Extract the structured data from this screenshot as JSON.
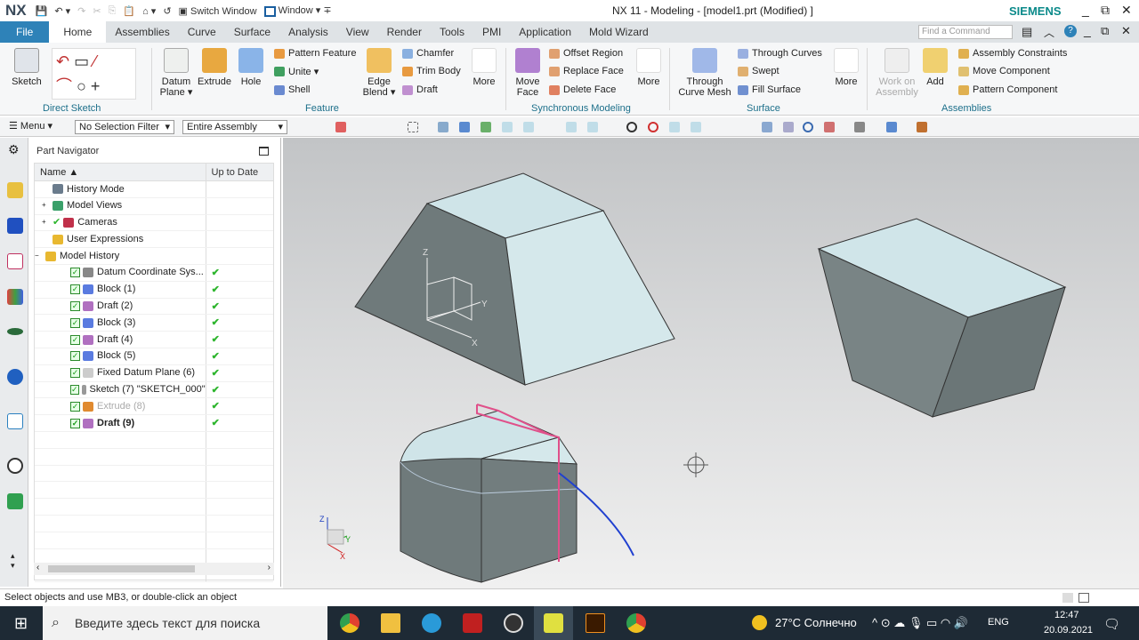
{
  "titlebar": {
    "logo": "NX",
    "switch_window": "Switch Window",
    "window": "Window ▾",
    "title": "NX 11 - Modeling - [model1.prt (Modified) ]",
    "brand": "SIEMENS",
    "minimize": "_",
    "restore": "⧉",
    "close": "✕"
  },
  "tabs": [
    "File",
    "Home",
    "Assemblies",
    "Curve",
    "Surface",
    "Analysis",
    "View",
    "Render",
    "Tools",
    "PMI",
    "Application",
    "Mold Wizard"
  ],
  "find_command": {
    "placeholder": "Find a Command"
  },
  "ribbon": {
    "sketch": "Sketch",
    "direct_sketch": "Direct Sketch",
    "datum_plane": "Datum Plane ▾",
    "extrude": "Extrude",
    "hole": "Hole",
    "pattern_feature": "Pattern Feature",
    "unite": "Unite ▾",
    "shell": "Shell",
    "edge_blend": "Edge Blend ▾",
    "chamfer": "Chamfer",
    "trim_body": "Trim Body",
    "draft": "Draft",
    "more": "More",
    "feature": "Feature",
    "move_face": "Move Face",
    "offset_region": "Offset Region",
    "replace_face": "Replace Face",
    "delete_face": "Delete Face",
    "sync_modeling": "Synchronous Modeling",
    "through_curve_mesh": "Through Curve Mesh",
    "through_curves": "Through Curves",
    "swept": "Swept",
    "fill_surface": "Fill Surface",
    "surface": "Surface",
    "work_on_assembly": "Work on Assembly",
    "add": "Add",
    "assembly_constraints": "Assembly Constraints",
    "move_component": "Move Component",
    "pattern_component": "Pattern Component",
    "assemblies": "Assemblies"
  },
  "toolbar": {
    "menu": "Menu ▾",
    "selection_filter": "No Selection Filter",
    "scope": "Entire Assembly"
  },
  "navigator": {
    "title": "Part Navigator",
    "col_name": "Name ▲",
    "col_uptodate": "Up to Date",
    "rows": [
      {
        "name": "History Mode",
        "icon": "clock-icon",
        "color": "#6a7b8c",
        "check": false,
        "uptodate": ""
      },
      {
        "name": "Model Views",
        "icon": "views-icon",
        "color": "#3aa06a",
        "check": false,
        "uptodate": ""
      },
      {
        "name": "Cameras",
        "icon": "camera-icon",
        "color": "#c0304a",
        "check": false,
        "uptodate": ""
      },
      {
        "name": "User Expressions",
        "icon": "folder-icon",
        "color": "#e8b830",
        "check": false,
        "uptodate": ""
      },
      {
        "name": "Model History",
        "icon": "folder-icon",
        "color": "#e8b830",
        "check": false,
        "uptodate": ""
      },
      {
        "name": "Datum Coordinate Sys...",
        "icon": "datum-csys-icon",
        "color": "#888",
        "check": true,
        "uptodate": "✔"
      },
      {
        "name": "Block (1)",
        "icon": "block-icon",
        "color": "#5a7be0",
        "check": true,
        "uptodate": "✔"
      },
      {
        "name": "Draft (2)",
        "icon": "draft-icon",
        "color": "#b070c0",
        "check": true,
        "uptodate": "✔"
      },
      {
        "name": "Block (3)",
        "icon": "block-icon",
        "color": "#5a7be0",
        "check": true,
        "uptodate": "✔"
      },
      {
        "name": "Draft (4)",
        "icon": "draft-icon",
        "color": "#b070c0",
        "check": true,
        "uptodate": "✔"
      },
      {
        "name": "Block (5)",
        "icon": "block-icon",
        "color": "#5a7be0",
        "check": true,
        "uptodate": "✔"
      },
      {
        "name": "Fixed Datum Plane (6)",
        "icon": "datum-plane-icon",
        "color": "#ccc",
        "check": true,
        "uptodate": "✔"
      },
      {
        "name": "Sketch (7) \"SKETCH_000\"",
        "icon": "sketch-icon",
        "color": "#999",
        "check": true,
        "uptodate": "✔"
      },
      {
        "name": "Extrude (8)",
        "icon": "extrude-icon",
        "color": "#e08a30",
        "check": true,
        "uptodate": "✔"
      },
      {
        "name": "Draft (9)",
        "icon": "draft-icon",
        "color": "#b070c0",
        "check": true,
        "uptodate": "✔"
      }
    ]
  },
  "viewport": {
    "axis_x": "X",
    "axis_y": "Y",
    "axis_z": "Z"
  },
  "status": "Select objects and use MB3, or double-click an object",
  "taskbar": {
    "search_placeholder": "Введите здесь текст для поиска",
    "weather": "27°C Солнечно",
    "lang": "ENG",
    "time": "12:47",
    "date": "20.09.2021"
  },
  "colors": {
    "file_tab": "#2e82b8",
    "brand": "#0b8a8a",
    "group_label": "#1c6f8a"
  }
}
